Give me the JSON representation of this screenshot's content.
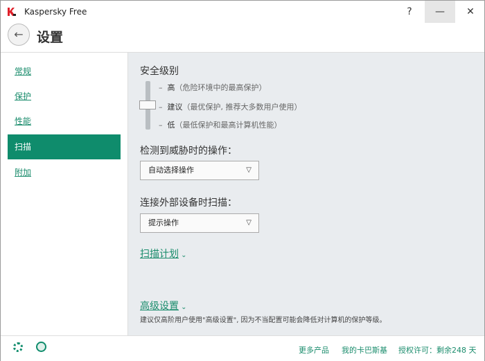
{
  "window": {
    "title": "Kaspersky Free",
    "help": "?",
    "minimize": "—",
    "close": "✕"
  },
  "header": {
    "title": "设置"
  },
  "sidebar": {
    "items": [
      {
        "label": "常规"
      },
      {
        "label": "保护"
      },
      {
        "label": "性能"
      },
      {
        "label": "扫描",
        "selected": true
      },
      {
        "label": "附加"
      }
    ]
  },
  "main": {
    "security_level": {
      "heading": "安全级别",
      "levels": [
        {
          "name": "高",
          "desc": "（危险环境中的最高保护）"
        },
        {
          "name": "建议",
          "desc": "（最优保护, 推荐大多数用户使用）"
        },
        {
          "name": "低",
          "desc": "（最低保护和最高计算机性能）"
        }
      ],
      "selected": "建议"
    },
    "threat_action": {
      "label": "检测到威胁时的操作：",
      "value": "自动选择操作"
    },
    "external_scan": {
      "label": "连接外部设备时扫描：",
      "value": "提示操作"
    },
    "schedule_link": "扫描计划",
    "advanced_link": "高级设置",
    "advanced_note": "建议仅高阶用户使用\"高级设置\", 因为不当配置可能会降低对计算机的保护等级。"
  },
  "footer": {
    "more_products": "更多产品",
    "my_kaspersky": "我的卡巴斯基",
    "license": "授权许可：剩余248 天"
  },
  "colors": {
    "accent": "#0f8c6c",
    "logo": "#e0202a"
  }
}
